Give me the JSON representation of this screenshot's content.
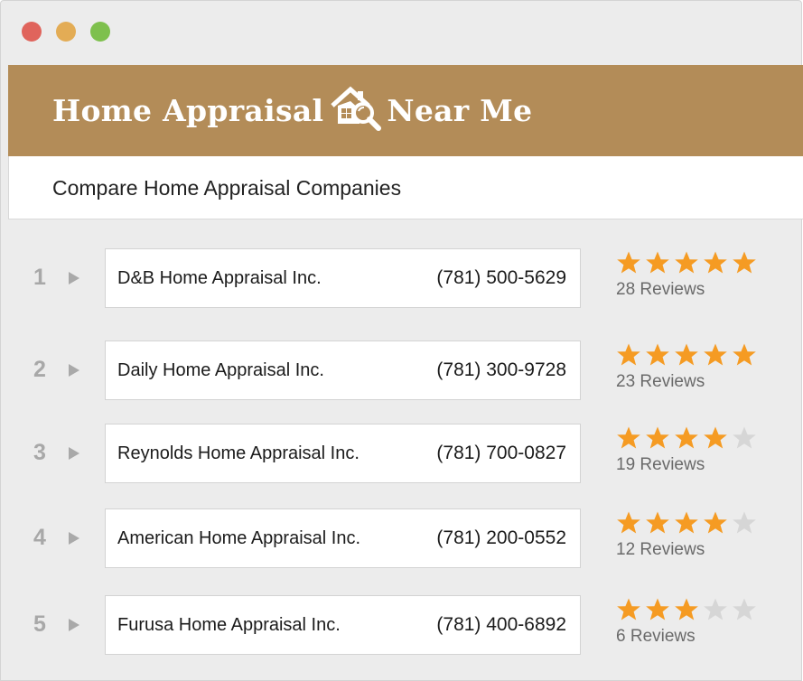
{
  "window": {
    "controls": [
      "close",
      "minimize",
      "zoom"
    ]
  },
  "header": {
    "title_left": "Home Appraisal",
    "title_right": "Near Me",
    "logo_icon": "house-magnifier-icon",
    "background": "#b38c58"
  },
  "subheader": {
    "title": "Compare Home Appraisal Companies"
  },
  "colors": {
    "star_filled": "#f59b23",
    "star_empty": "#d6d6d6",
    "rank": "#a8a8a8"
  },
  "companies": [
    {
      "rank": "1",
      "name": "D&B Home Appraisal Inc.",
      "phone": "(781) 500-5629",
      "rating": 5,
      "max_rating": 5,
      "reviews": "28 Reviews"
    },
    {
      "rank": "2",
      "name": "Daily Home Appraisal Inc.",
      "phone": "(781) 300-9728",
      "rating": 5,
      "max_rating": 5,
      "reviews": "23 Reviews"
    },
    {
      "rank": "3",
      "name": "Reynolds Home Appraisal Inc.",
      "phone": "(781) 700-0827",
      "rating": 4,
      "max_rating": 5,
      "reviews": "19 Reviews"
    },
    {
      "rank": "4",
      "name": "American Home Appraisal Inc.",
      "phone": "(781) 200-0552",
      "rating": 4,
      "max_rating": 5,
      "reviews": "12 Reviews"
    },
    {
      "rank": "5",
      "name": "Furusa Home Appraisal Inc.",
      "phone": "(781) 400-6892",
      "rating": 3,
      "max_rating": 5,
      "reviews": "6 Reviews"
    }
  ]
}
